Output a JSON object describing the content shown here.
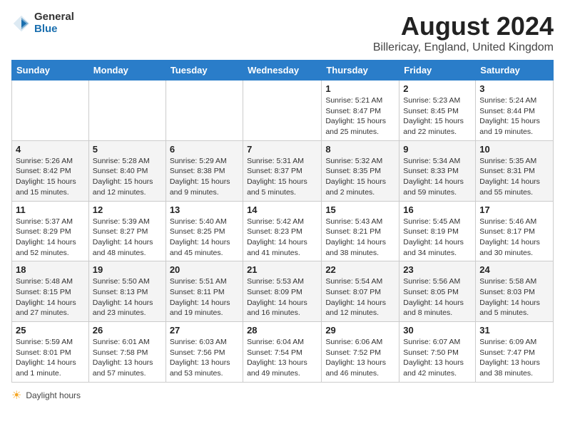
{
  "header": {
    "logo_general": "General",
    "logo_blue": "Blue",
    "main_title": "August 2024",
    "subtitle": "Billericay, England, United Kingdom"
  },
  "days_of_week": [
    "Sunday",
    "Monday",
    "Tuesday",
    "Wednesday",
    "Thursday",
    "Friday",
    "Saturday"
  ],
  "weeks": [
    [
      {
        "day": "",
        "info": ""
      },
      {
        "day": "",
        "info": ""
      },
      {
        "day": "",
        "info": ""
      },
      {
        "day": "",
        "info": ""
      },
      {
        "day": "1",
        "info": "Sunrise: 5:21 AM\nSunset: 8:47 PM\nDaylight: 15 hours\nand 25 minutes."
      },
      {
        "day": "2",
        "info": "Sunrise: 5:23 AM\nSunset: 8:45 PM\nDaylight: 15 hours\nand 22 minutes."
      },
      {
        "day": "3",
        "info": "Sunrise: 5:24 AM\nSunset: 8:44 PM\nDaylight: 15 hours\nand 19 minutes."
      }
    ],
    [
      {
        "day": "4",
        "info": "Sunrise: 5:26 AM\nSunset: 8:42 PM\nDaylight: 15 hours\nand 15 minutes."
      },
      {
        "day": "5",
        "info": "Sunrise: 5:28 AM\nSunset: 8:40 PM\nDaylight: 15 hours\nand 12 minutes."
      },
      {
        "day": "6",
        "info": "Sunrise: 5:29 AM\nSunset: 8:38 PM\nDaylight: 15 hours\nand 9 minutes."
      },
      {
        "day": "7",
        "info": "Sunrise: 5:31 AM\nSunset: 8:37 PM\nDaylight: 15 hours\nand 5 minutes."
      },
      {
        "day": "8",
        "info": "Sunrise: 5:32 AM\nSunset: 8:35 PM\nDaylight: 15 hours\nand 2 minutes."
      },
      {
        "day": "9",
        "info": "Sunrise: 5:34 AM\nSunset: 8:33 PM\nDaylight: 14 hours\nand 59 minutes."
      },
      {
        "day": "10",
        "info": "Sunrise: 5:35 AM\nSunset: 8:31 PM\nDaylight: 14 hours\nand 55 minutes."
      }
    ],
    [
      {
        "day": "11",
        "info": "Sunrise: 5:37 AM\nSunset: 8:29 PM\nDaylight: 14 hours\nand 52 minutes."
      },
      {
        "day": "12",
        "info": "Sunrise: 5:39 AM\nSunset: 8:27 PM\nDaylight: 14 hours\nand 48 minutes."
      },
      {
        "day": "13",
        "info": "Sunrise: 5:40 AM\nSunset: 8:25 PM\nDaylight: 14 hours\nand 45 minutes."
      },
      {
        "day": "14",
        "info": "Sunrise: 5:42 AM\nSunset: 8:23 PM\nDaylight: 14 hours\nand 41 minutes."
      },
      {
        "day": "15",
        "info": "Sunrise: 5:43 AM\nSunset: 8:21 PM\nDaylight: 14 hours\nand 38 minutes."
      },
      {
        "day": "16",
        "info": "Sunrise: 5:45 AM\nSunset: 8:19 PM\nDaylight: 14 hours\nand 34 minutes."
      },
      {
        "day": "17",
        "info": "Sunrise: 5:46 AM\nSunset: 8:17 PM\nDaylight: 14 hours\nand 30 minutes."
      }
    ],
    [
      {
        "day": "18",
        "info": "Sunrise: 5:48 AM\nSunset: 8:15 PM\nDaylight: 14 hours\nand 27 minutes."
      },
      {
        "day": "19",
        "info": "Sunrise: 5:50 AM\nSunset: 8:13 PM\nDaylight: 14 hours\nand 23 minutes."
      },
      {
        "day": "20",
        "info": "Sunrise: 5:51 AM\nSunset: 8:11 PM\nDaylight: 14 hours\nand 19 minutes."
      },
      {
        "day": "21",
        "info": "Sunrise: 5:53 AM\nSunset: 8:09 PM\nDaylight: 14 hours\nand 16 minutes."
      },
      {
        "day": "22",
        "info": "Sunrise: 5:54 AM\nSunset: 8:07 PM\nDaylight: 14 hours\nand 12 minutes."
      },
      {
        "day": "23",
        "info": "Sunrise: 5:56 AM\nSunset: 8:05 PM\nDaylight: 14 hours\nand 8 minutes."
      },
      {
        "day": "24",
        "info": "Sunrise: 5:58 AM\nSunset: 8:03 PM\nDaylight: 14 hours\nand 5 minutes."
      }
    ],
    [
      {
        "day": "25",
        "info": "Sunrise: 5:59 AM\nSunset: 8:01 PM\nDaylight: 14 hours\nand 1 minute."
      },
      {
        "day": "26",
        "info": "Sunrise: 6:01 AM\nSunset: 7:58 PM\nDaylight: 13 hours\nand 57 minutes."
      },
      {
        "day": "27",
        "info": "Sunrise: 6:03 AM\nSunset: 7:56 PM\nDaylight: 13 hours\nand 53 minutes."
      },
      {
        "day": "28",
        "info": "Sunrise: 6:04 AM\nSunset: 7:54 PM\nDaylight: 13 hours\nand 49 minutes."
      },
      {
        "day": "29",
        "info": "Sunrise: 6:06 AM\nSunset: 7:52 PM\nDaylight: 13 hours\nand 46 minutes."
      },
      {
        "day": "30",
        "info": "Sunrise: 6:07 AM\nSunset: 7:50 PM\nDaylight: 13 hours\nand 42 minutes."
      },
      {
        "day": "31",
        "info": "Sunrise: 6:09 AM\nSunset: 7:47 PM\nDaylight: 13 hours\nand 38 minutes."
      }
    ]
  ],
  "footer": {
    "daylight_label": "Daylight hours"
  }
}
